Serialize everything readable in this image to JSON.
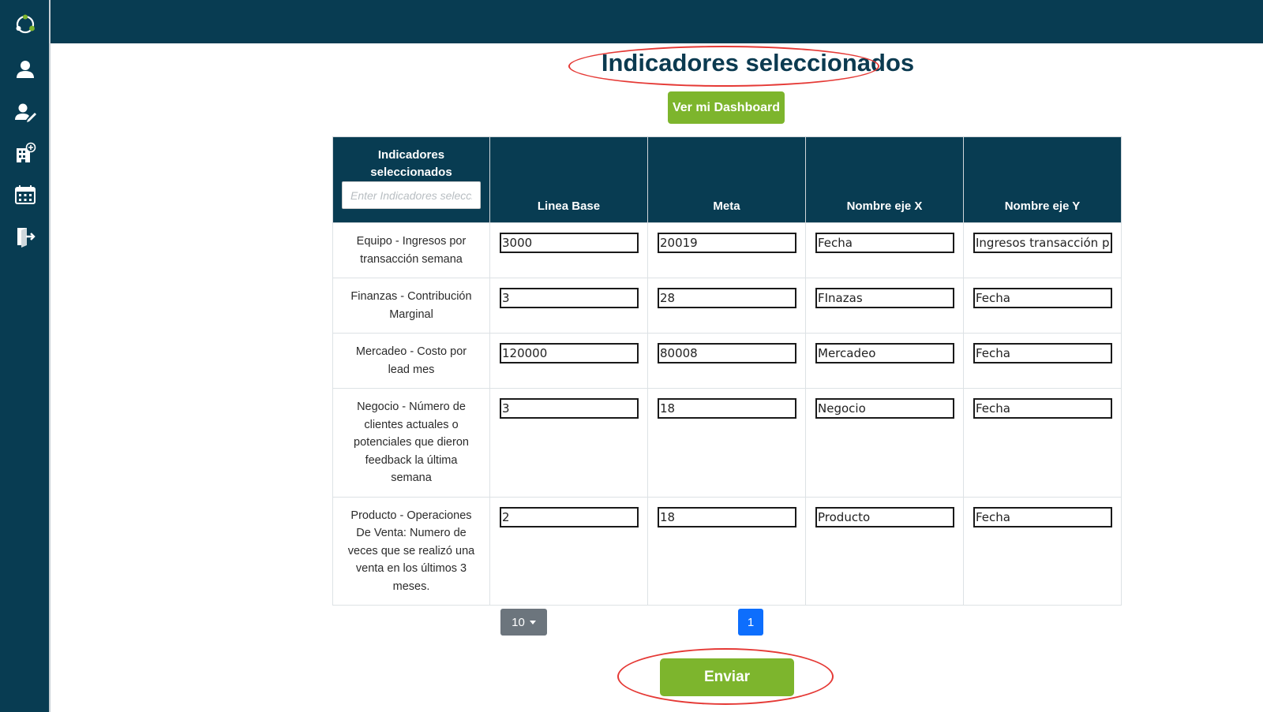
{
  "sidebar": {
    "icons": [
      "app-logo-icon",
      "user-icon",
      "user-edit-icon",
      "building-add-icon",
      "calendar-icon",
      "logout-icon"
    ]
  },
  "page": {
    "title": "Indicadores seleccionados",
    "dashboard_button": "Ver mi Dashboard",
    "submit_button": "Enviar"
  },
  "table": {
    "headers": [
      "Indicadores seleccionados",
      "Linea Base",
      "Meta",
      "Nombre eje X",
      "Nombre eje Y"
    ],
    "filter_placeholder": "Enter Indicadores seleccionados",
    "rows": [
      {
        "name": "Equipo - Ingresos por transacción semana",
        "linea_base": "3000",
        "meta": "20019",
        "eje_x": "Fecha",
        "eje_y": "Ingresos transacción por semana"
      },
      {
        "name": "Finanzas - Contribución Marginal",
        "linea_base": "3",
        "meta": "28",
        "eje_x": "FInazas",
        "eje_y": "Fecha"
      },
      {
        "name": "Mercadeo - Costo por lead mes",
        "linea_base": "120000",
        "meta": "80008",
        "eje_x": "Mercadeo",
        "eje_y": "Fecha"
      },
      {
        "name": "Negocio - Número de clientes actuales o potenciales que dieron feedback la última semana",
        "linea_base": "3",
        "meta": "18",
        "eje_x": "Negocio",
        "eje_y": "Fecha"
      },
      {
        "name": "Producto - Operaciones De Venta: Numero de veces que se realizó una venta en los últimos 3 meses.",
        "linea_base": "2",
        "meta": "18",
        "eje_x": "Producto",
        "eje_y": "Fecha"
      }
    ]
  },
  "pagination": {
    "page_size": "10",
    "current_page": "1"
  },
  "colors": {
    "navy": "#083c52",
    "green": "#7db52d",
    "highlight_red": "#e53935",
    "page_blue": "#0d6efd",
    "grey_button": "#6c757d"
  }
}
